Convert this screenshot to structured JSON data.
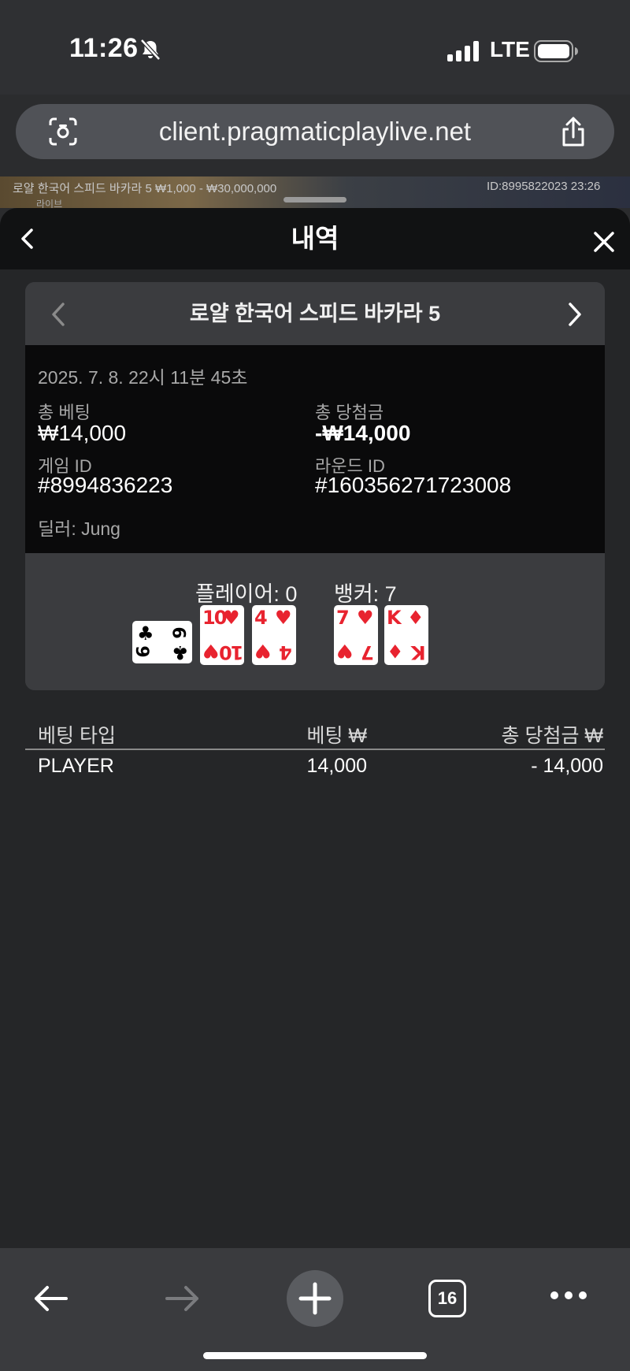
{
  "status_bar": {
    "time": "11:26",
    "network": "LTE"
  },
  "url_bar": {
    "url": "client.pragmaticplaylive.net"
  },
  "background_strip": {
    "left_text": "로얄 한국어 스피드 바카라 5  ₩1,000 - ₩30,000,000",
    "right_text": "ID:8995822023  23:26",
    "sub_text": "라이브"
  },
  "sheet": {
    "title": "내역",
    "game_card": {
      "table_name": "로얄 한국어 스피드 바카라 5",
      "datetime": "2025. 7. 8. 22시 11분 45초",
      "total_bet_label": "총 베팅",
      "total_bet_value": "₩14,000",
      "total_win_label": "총 당첨금",
      "total_win_value": "-₩14,000",
      "game_id_label": "게임 ID",
      "game_id_value": "#8994836223",
      "round_id_label": "라운드 ID",
      "round_id_value": "#160356271723008",
      "dealer": "딜러: Jung",
      "player_label": "플레이어: 0",
      "banker_label": "뱅커: 7",
      "player_cards": [
        {
          "rank": "6",
          "suit": "♣",
          "color": "#000000",
          "rotated": true
        },
        {
          "rank": "10",
          "suit": "♥",
          "color": "#e8232f",
          "rotated": false
        },
        {
          "rank": "4",
          "suit": "♥",
          "color": "#e8232f",
          "rotated": false
        }
      ],
      "banker_cards": [
        {
          "rank": "7",
          "suit": "♥",
          "color": "#e8232f",
          "rotated": false
        },
        {
          "rank": "K",
          "suit": "♦",
          "color": "#e8232f",
          "rotated": false
        }
      ]
    },
    "bets_table": {
      "headers": {
        "type": "베팅 타입",
        "bet": "베팅 ₩",
        "win": "총 당첨금 ₩"
      },
      "rows": [
        {
          "type": "PLAYER",
          "bet": "14,000",
          "win": "- 14,000"
        }
      ]
    }
  },
  "toolbar": {
    "tabs_count": "16"
  }
}
